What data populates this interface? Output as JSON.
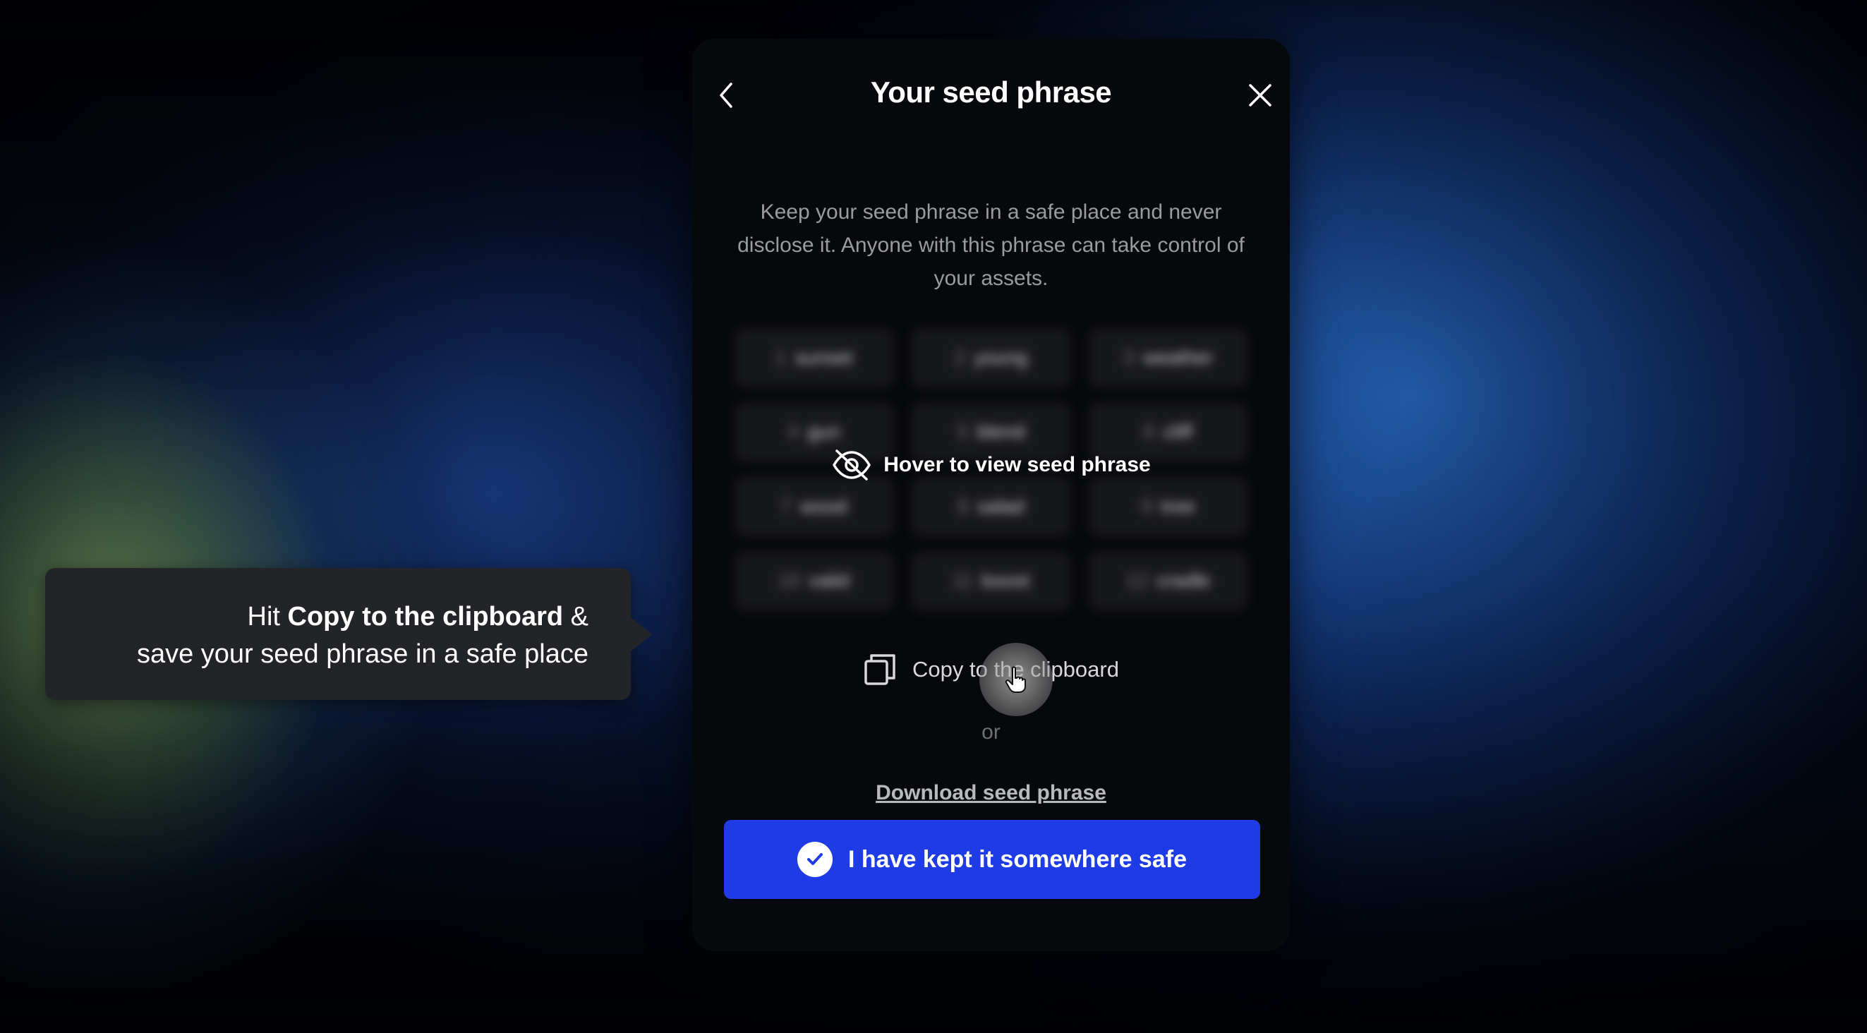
{
  "modal": {
    "title": "Your seed phrase",
    "description": "Keep your seed phrase in a safe place and never disclose it. Anyone with this phrase can take control of your assets.",
    "seed_words": [
      {
        "num": "1",
        "word": "sunset"
      },
      {
        "num": "2",
        "word": "young"
      },
      {
        "num": "3",
        "word": "weather"
      },
      {
        "num": "4",
        "word": "gun"
      },
      {
        "num": "5",
        "word": "blend"
      },
      {
        "num": "6",
        "word": "cliff"
      },
      {
        "num": "7",
        "word": "wood"
      },
      {
        "num": "8",
        "word": "salad"
      },
      {
        "num": "9",
        "word": "tree"
      },
      {
        "num": "10",
        "word": "valid"
      },
      {
        "num": "11",
        "word": "boost"
      },
      {
        "num": "12",
        "word": "cradle"
      }
    ],
    "hover_label": "Hover to view seed phrase",
    "copy_label": "Copy to the clipboard",
    "or_label": "or",
    "download_label": "Download seed phrase",
    "confirm_label": "I have kept it somewhere safe"
  },
  "callout": {
    "prefix": "Hit ",
    "emphasis": "Copy to the clipboard",
    "suffix": " &",
    "line2": "save your seed phrase in a safe place"
  },
  "icons": {
    "back": "chevron-left-icon",
    "close": "close-icon",
    "hidden": "eye-off-icon",
    "copy": "copy-icon",
    "check": "check-icon",
    "cursor": "hand-pointer-icon"
  },
  "colors": {
    "accent": "#1f3be6",
    "modal_bg": "#07080b",
    "callout_bg": "#232427"
  }
}
